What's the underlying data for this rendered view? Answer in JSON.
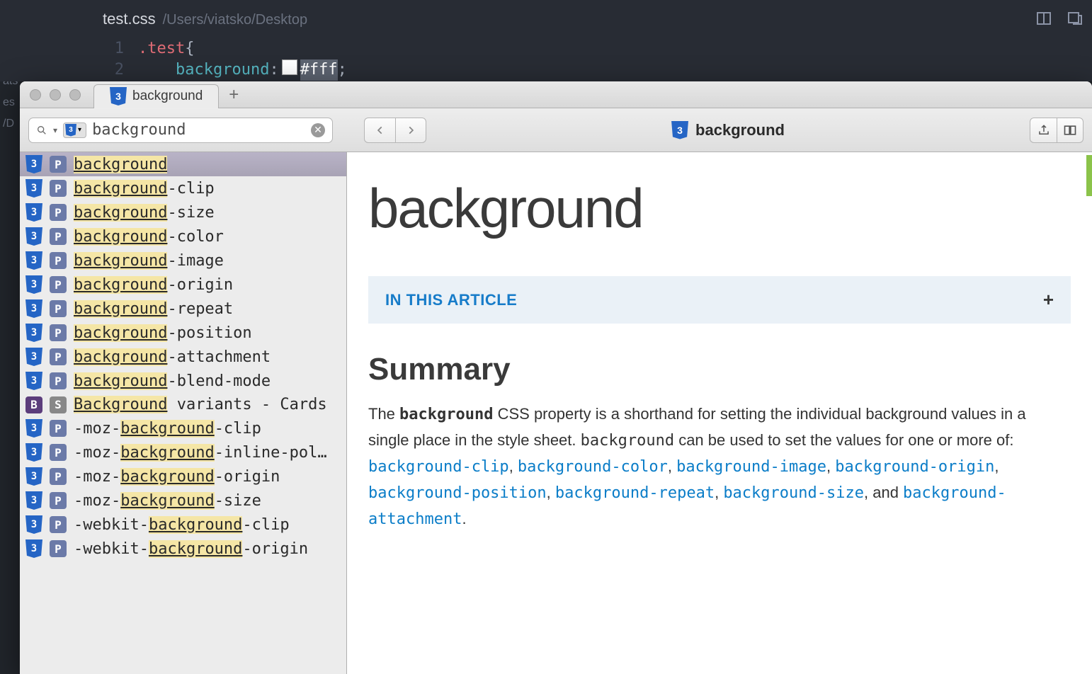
{
  "editor": {
    "filename": "test.css",
    "filepath": "/Users/viatsko/Desktop",
    "lines": [
      {
        "num": "1",
        "selector": ".test",
        "brace": " {"
      },
      {
        "num": "2",
        "indent": "    ",
        "prop": "background",
        "value": "#fff"
      }
    ]
  },
  "docs": {
    "tab_title": "background",
    "search_value": "background",
    "page_title": "background",
    "results": [
      {
        "icon1": "css",
        "icon2": "P",
        "highlight": "background",
        "rest": "",
        "selected": true
      },
      {
        "icon1": "css",
        "icon2": "P",
        "highlight": "background",
        "rest": "-clip"
      },
      {
        "icon1": "css",
        "icon2": "P",
        "highlight": "background",
        "rest": "-size"
      },
      {
        "icon1": "css",
        "icon2": "P",
        "highlight": "background",
        "rest": "-color"
      },
      {
        "icon1": "css",
        "icon2": "P",
        "highlight": "background",
        "rest": "-image"
      },
      {
        "icon1": "css",
        "icon2": "P",
        "highlight": "background",
        "rest": "-origin"
      },
      {
        "icon1": "css",
        "icon2": "P",
        "highlight": "background",
        "rest": "-repeat"
      },
      {
        "icon1": "css",
        "icon2": "P",
        "highlight": "background",
        "rest": "-position"
      },
      {
        "icon1": "css",
        "icon2": "P",
        "highlight": "background",
        "rest": "-attachment"
      },
      {
        "icon1": "css",
        "icon2": "P",
        "highlight": "background",
        "rest": "-blend-mode"
      },
      {
        "icon1": "B",
        "icon2": "S",
        "highlight": "Background",
        "rest": " variants - Cards"
      },
      {
        "icon1": "css",
        "icon2": "P",
        "pre": "-moz-",
        "highlight": "background",
        "rest": "-clip"
      },
      {
        "icon1": "css",
        "icon2": "P",
        "pre": "-moz-",
        "highlight": "background",
        "rest": "-inline-pol…"
      },
      {
        "icon1": "css",
        "icon2": "P",
        "pre": "-moz-",
        "highlight": "background",
        "rest": "-origin"
      },
      {
        "icon1": "css",
        "icon2": "P",
        "pre": "-moz-",
        "highlight": "background",
        "rest": "-size"
      },
      {
        "icon1": "css",
        "icon2": "P",
        "pre": "-webkit-",
        "highlight": "background",
        "rest": "-clip"
      },
      {
        "icon1": "css",
        "icon2": "P",
        "pre": "-webkit-",
        "highlight": "background",
        "rest": "-origin"
      }
    ],
    "article": {
      "h1": "background",
      "toc_label": "IN THIS ARTICLE",
      "summary_heading": "Summary",
      "summary_pieces": {
        "t1": "The ",
        "code1": "background",
        "t2": " CSS property is a shorthand for setting the individual background values in a single place in the style sheet. ",
        "code2": "background",
        "t3": " can be used to set the values for one or more of: ",
        "links": [
          "background-clip",
          "background-color",
          "background-image",
          "background-origin",
          "background-position",
          "background-repeat",
          "background-size"
        ],
        "and": ", and ",
        "last_link": "background-attachment",
        "period": "."
      }
    }
  }
}
